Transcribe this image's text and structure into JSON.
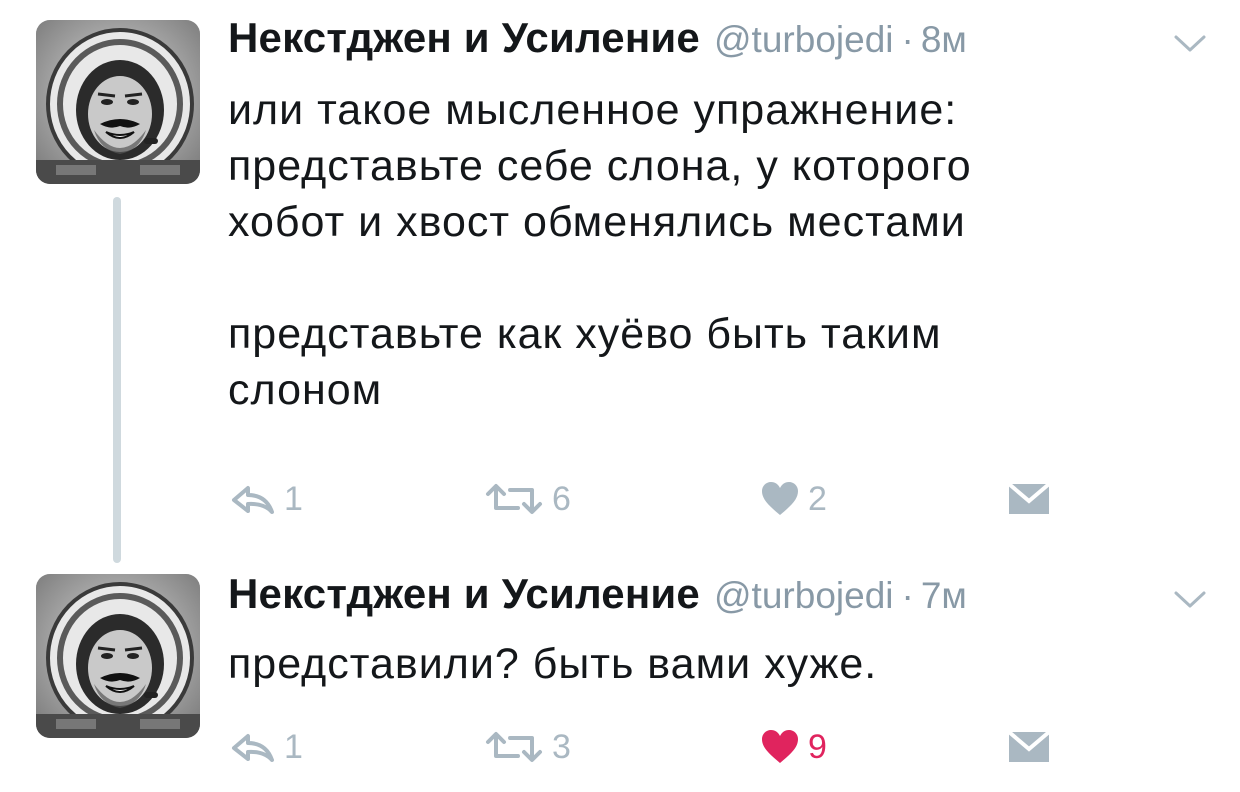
{
  "tweets": [
    {
      "author": {
        "display_name": "Некстджен и Усиление",
        "handle": "@turbojedi",
        "separator": "·",
        "time": "8м",
        "avatar": "astronaut-avatar"
      },
      "text": "или такое мысленное упражнение:\nпредставьте себе слона, у которого\nхобот и хвост обменялись местами\n\nпредставьте как хуёво быть таким\nслоном",
      "actions": {
        "reply": {
          "icon": "reply-icon",
          "count": "1"
        },
        "retweet": {
          "icon": "retweet-icon",
          "count": "6"
        },
        "like": {
          "icon": "heart-icon",
          "count": "2",
          "liked": false
        },
        "dm": {
          "icon": "envelope-icon"
        }
      },
      "menu_icon": "chevron-down-icon"
    },
    {
      "author": {
        "display_name": "Некстджен и Усиление",
        "handle": "@turbojedi",
        "separator": "·",
        "time": "7м",
        "avatar": "astronaut-avatar"
      },
      "text": "представили? быть вами хуже.",
      "actions": {
        "reply": {
          "icon": "reply-icon",
          "count": "1"
        },
        "retweet": {
          "icon": "retweet-icon",
          "count": "3"
        },
        "like": {
          "icon": "heart-icon",
          "count": "9",
          "liked": true
        },
        "dm": {
          "icon": "envelope-icon"
        }
      },
      "menu_icon": "chevron-down-icon"
    }
  ],
  "colors": {
    "text": "#14171a",
    "secondary": "#8899a6",
    "action_icon": "#aab8c2",
    "like_active": "#e0245e",
    "thread_line": "#cfd9de"
  }
}
